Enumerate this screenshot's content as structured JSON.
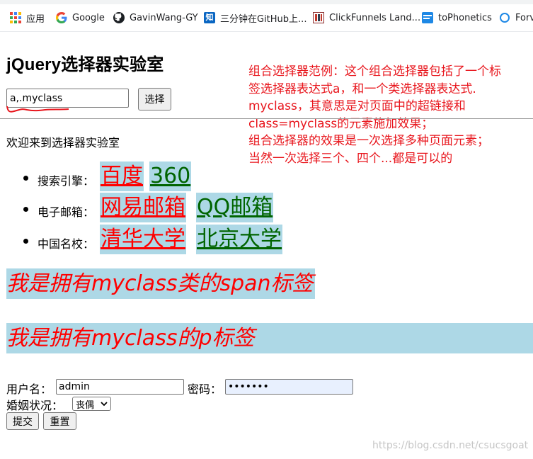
{
  "bookmarks": {
    "items": [
      {
        "label": "应用",
        "icon": "apps-grid-icon"
      },
      {
        "label": "Google",
        "icon": "google-icon"
      },
      {
        "label": "GavinWang-GY",
        "icon": "github-icon"
      },
      {
        "label": "三分钟在GitHub上...",
        "icon": "zhihu-icon"
      },
      {
        "label": "ClickFunnels Land...",
        "icon": "clickfunnels-icon"
      },
      {
        "label": "toPhonetics",
        "icon": "tophonetics-icon"
      },
      {
        "label": "Forv",
        "icon": "forvo-icon"
      }
    ]
  },
  "page": {
    "title": "jQuery选择器实验室",
    "note_lines": [
      "组合选择器范例：这个组合选择器包括了一个标",
      "签选择器表达式a，和一个类选择器表达式.",
      "myclass，其意思是对页面中的超链接和",
      "class=myclass的元素施加效果；",
      "组合选择器的效果是一次选择多种页面元素；",
      "当然一次选择三个、四个...都是可以的"
    ],
    "selector_value": "a,.myclass",
    "select_button_label": "选择",
    "welcome": "欢迎来到选择器实验室"
  },
  "links": [
    {
      "category": "搜索引擎：",
      "a": "百度",
      "b": "360"
    },
    {
      "category": "电子邮箱：",
      "a": "网易邮箱",
      "b": "QQ邮箱"
    },
    {
      "category": "中国名校：",
      "a": "清华大学",
      "b": "北京大学"
    }
  ],
  "span_text": "我是拥有myclass类的span标签",
  "p_text": "我是拥有myclass的p标签",
  "form": {
    "username_label": "用户名：",
    "username_value": "admin",
    "password_label": "密码：",
    "password_value": "•••••••",
    "marital_label": "婚姻状况：",
    "marital_selected": "丧偶",
    "submit_label": "提交",
    "reset_label": "重置"
  },
  "watermark": "https://blog.csdn.net/csucsgoat",
  "colors": {
    "highlight_bg": "#add8e6",
    "link_red": "#ff0000",
    "link_green": "#006400",
    "note_red": "#e8151c"
  }
}
